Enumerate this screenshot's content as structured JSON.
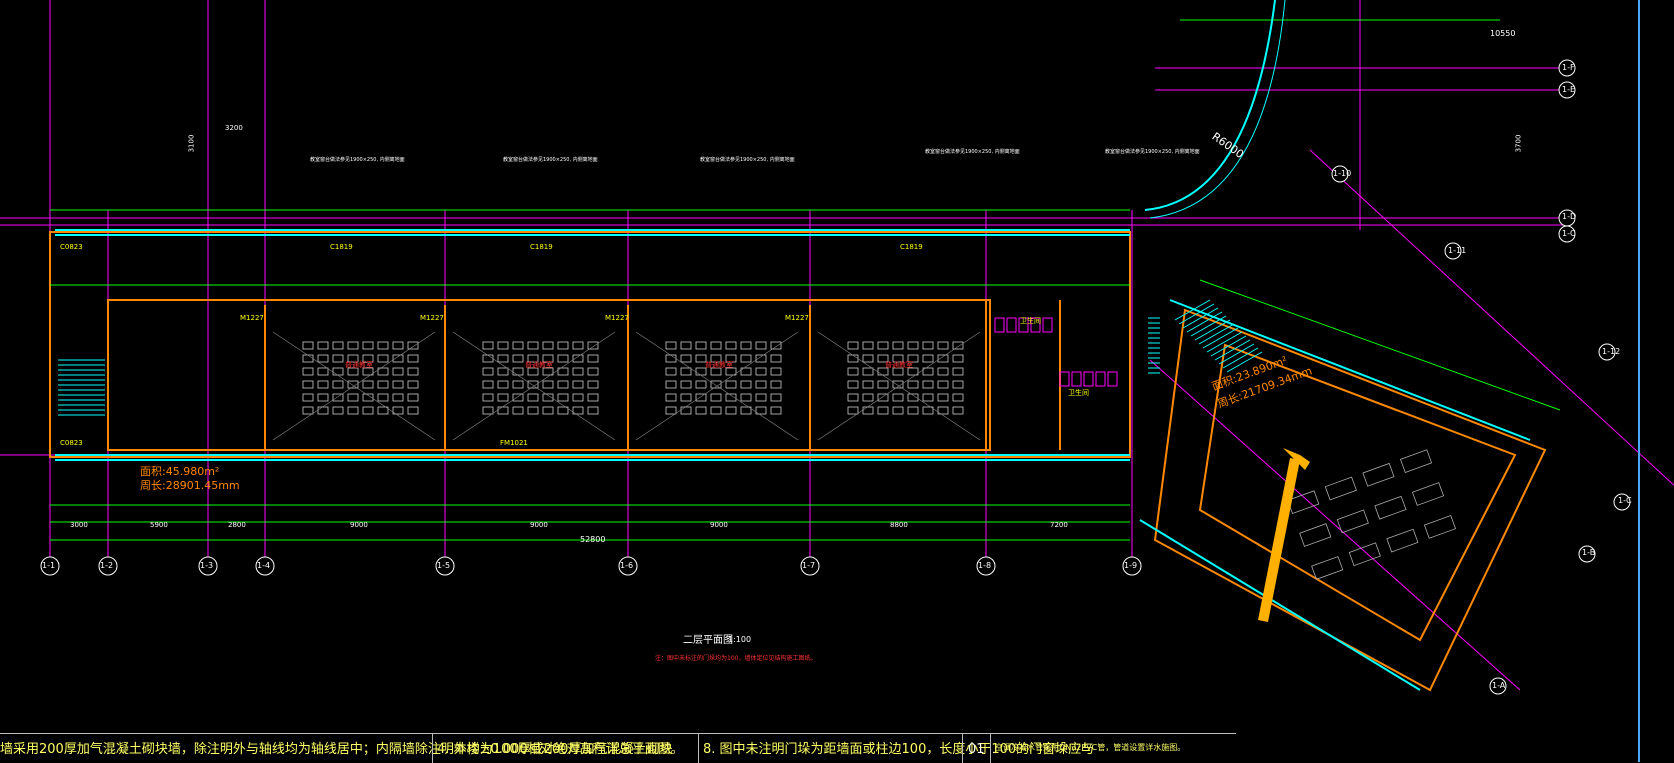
{
  "drawing": {
    "title": "二层平面图",
    "scale": "1:100",
    "note_under_title": "注：图中未标注的门垛均为100，墙体定位见结构施工图纸。"
  },
  "dimensions": {
    "total": "52800",
    "bays": [
      "3000",
      "5900",
      "2800",
      "9000",
      "9000",
      "9000",
      "8800",
      "7200"
    ],
    "top_right": "10550",
    "radius": "R6000",
    "top_mid": [
      "3100",
      "3200",
      "3700"
    ]
  },
  "grid_labels": {
    "bottom": [
      "1-1",
      "1-2",
      "1-3",
      "1-4",
      "1-5",
      "1-6",
      "1-7",
      "1-8",
      "1-9"
    ],
    "right": [
      "1-F",
      "1-E",
      "1-D",
      "1-C",
      "1-C",
      "1-B"
    ],
    "diagonal": [
      "1-10",
      "1-11",
      "1-12",
      "1-A"
    ]
  },
  "area_labels": [
    {
      "area": "面积:45.980m²",
      "perimeter": "周长:28901.45mm"
    },
    {
      "area": "面积:23.890m²",
      "perimeter": "周长:21709.34mm"
    }
  ],
  "room_labels": [
    "普通教室",
    "普通教室",
    "普通教室",
    "普通教室",
    "卫生间",
    "卫生间"
  ],
  "window_tags": [
    "C0823",
    "C0823",
    "C1819",
    "C1819",
    "C1819",
    "M1227",
    "M1227",
    "M1227",
    "M1227",
    "FM1021"
  ],
  "callouts": [
    "教室窗台做法参见1900×250, 内侧离地面",
    "教室窗台做法参见1900×250, 内侧离地面",
    "教室窗台做法参见1900×250, 内侧离地面",
    "教室窗台做法参见1900×250, 内侧离地面",
    "教室窗台做法参见1900×250, 内侧离地面"
  ],
  "bottom_notes": [
    "墙采用200厚加气混凝土砌块墙，除注明外与轴线均为轴线居中；内隔墙除注明外均为100厚或200厚加气混凝土砌块",
    "4. 本楼±0.000相对绝对高程详总平面图。",
    "8. 图中未注明门垛为距墙面或柱边100，长度小于100的门窗垛应与",
    "01",
    "空调冷凝水管采用DN32PVC管，管道设置详水施图。"
  ],
  "colors": {
    "background": "#000000",
    "wall": "#ff8800",
    "axis": "#ff00ff",
    "dim": "#00ff00",
    "window": "#00ffff",
    "text": "#ffff00",
    "white": "#ffffff",
    "red": "#ff3333",
    "arrow": "#ffb000",
    "frame": "#4aa8ff"
  }
}
